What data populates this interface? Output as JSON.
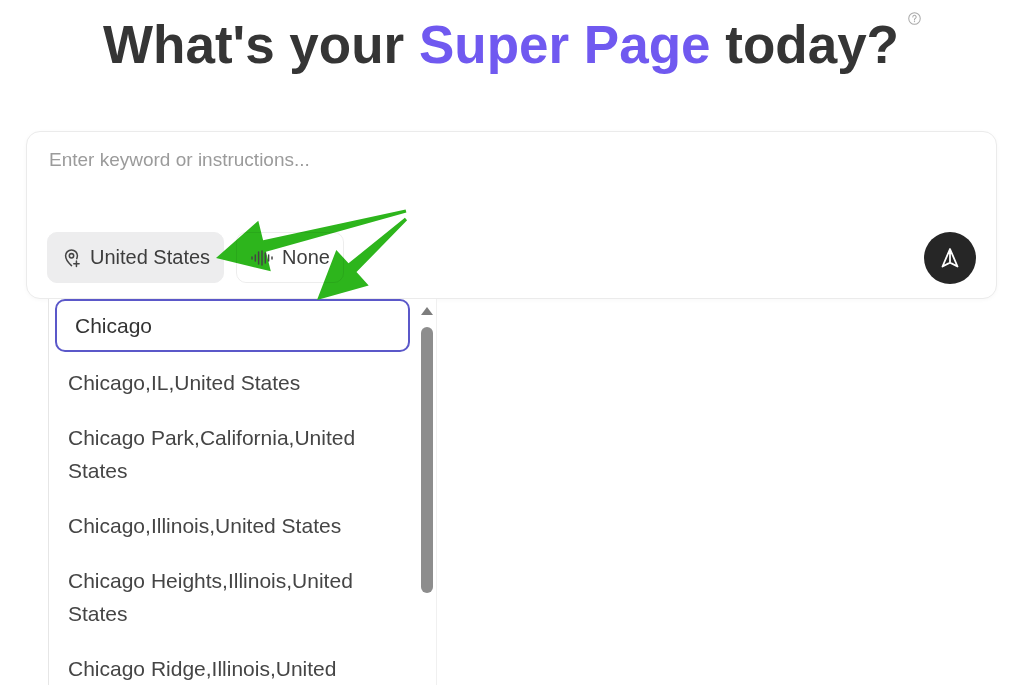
{
  "heading": {
    "lead": "What's your",
    "highlight": "Super Page",
    "tail": "today?"
  },
  "prompt": {
    "placeholder": "Enter keyword or instructions...",
    "chips": [
      {
        "kind": "location",
        "label": "United States",
        "active": true
      },
      {
        "kind": "voice",
        "label": "None",
        "active": false
      }
    ]
  },
  "location_dropdown": {
    "search_value": "Chicago",
    "options": [
      {
        "label": "Chicago,IL,United States",
        "selected": false
      },
      {
        "label": "Chicago Park,California,United States",
        "selected": false
      },
      {
        "label": "Chicago,Illinois,United States",
        "selected": false
      },
      {
        "label": "Chicago Heights,Illinois,United States",
        "selected": false
      },
      {
        "label": "Chicago Ridge,Illinois,United",
        "selected": false
      }
    ]
  }
}
